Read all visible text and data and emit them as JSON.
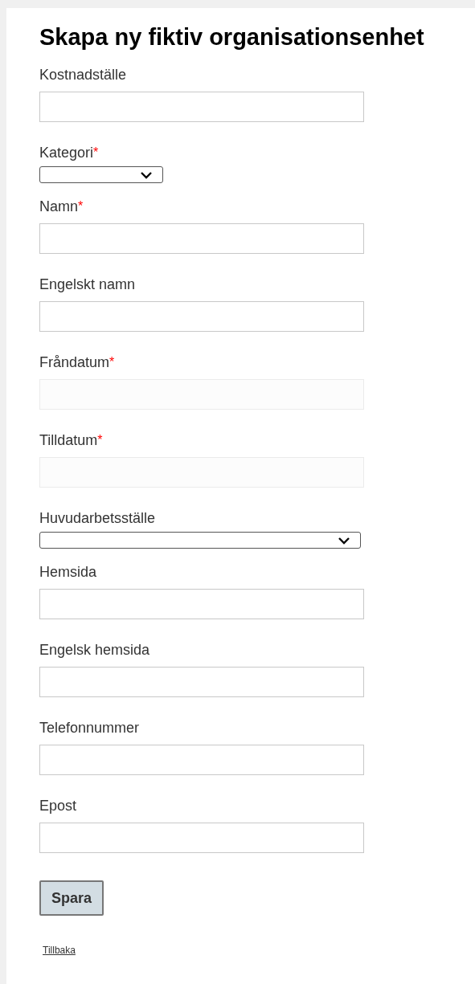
{
  "title": "Skapa ny fiktiv organisationsenhet",
  "fields": [
    {
      "kind": "text",
      "label": "Kostnadställe",
      "required": false,
      "disabled": false
    },
    {
      "kind": "select",
      "label": "Kategori",
      "required": true
    },
    {
      "kind": "text",
      "label": "Namn",
      "required": true,
      "disabled": false
    },
    {
      "kind": "text",
      "label": "Engelskt namn",
      "required": false,
      "disabled": false
    },
    {
      "kind": "text",
      "label": "Fråndatum",
      "required": true,
      "disabled": true
    },
    {
      "kind": "text",
      "label": "Tilldatum",
      "required": true,
      "disabled": true
    },
    {
      "kind": "wideselect",
      "label": "Huvudarbetsställe",
      "required": false
    },
    {
      "kind": "text",
      "label": "Hemsida",
      "required": false,
      "disabled": false
    },
    {
      "kind": "text",
      "label": "Engelsk hemsida",
      "required": false,
      "disabled": false
    },
    {
      "kind": "text",
      "label": "Telefonnummer",
      "required": false,
      "disabled": false
    },
    {
      "kind": "text",
      "label": "Epost",
      "required": false,
      "disabled": false
    }
  ],
  "required_mark": "*",
  "save_button": "Spara",
  "back_link": "Tillbaka"
}
